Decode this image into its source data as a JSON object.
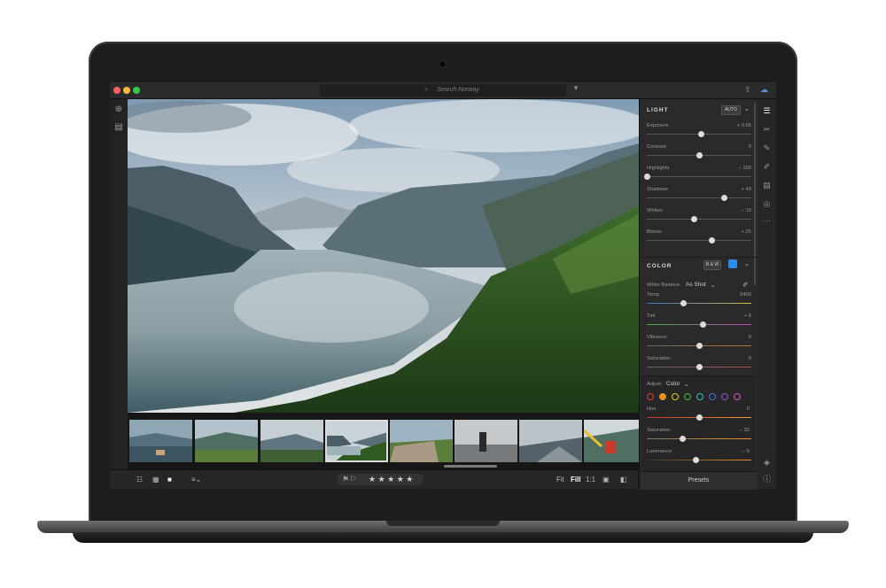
{
  "topbar": {
    "search_placeholder": "Search Norway",
    "icons": {
      "search": "search-icon",
      "filter": "filter-icon",
      "share": "share-icon",
      "cloud": "cloud-sync-icon"
    }
  },
  "leftbar": {
    "icons": [
      "add-icon",
      "library-icon"
    ]
  },
  "bottombar": {
    "fit": "Fit",
    "fill": "Fill",
    "one_to_one": "1:1",
    "stars": "★ ★ ★ ★ ★"
  },
  "panel": {
    "light": {
      "title": "LIGHT",
      "auto": "AUTO",
      "sliders": [
        {
          "label": "Exposure",
          "value": "+ 0.65",
          "level": 0.52
        },
        {
          "label": "Contrast",
          "value": "0",
          "level": 0.5
        },
        {
          "label": "Highlights",
          "value": "− 100",
          "level": 0.0
        },
        {
          "label": "Shadows",
          "value": "+ 49",
          "level": 0.74
        },
        {
          "label": "Whites",
          "value": "− 10",
          "level": 0.45
        },
        {
          "label": "Blacks",
          "value": "+ 25",
          "level": 0.62
        }
      ]
    },
    "color": {
      "title": "COLOR",
      "bw": "B & W",
      "white_balance_label": "White Balance",
      "white_balance_value": "As Shot",
      "sliders": [
        {
          "label": "Temp",
          "value": "5400",
          "level": 0.35
        },
        {
          "label": "Tint",
          "value": "+ 6",
          "level": 0.53
        },
        {
          "label": "Vibrance",
          "value": "0",
          "level": 0.5
        },
        {
          "label": "Saturation",
          "value": "0",
          "level": 0.5
        }
      ]
    },
    "adjust": {
      "label": "Adjust",
      "mode": "Color",
      "swatches": [
        "#e04040",
        "#e89020",
        "#e0d020",
        "#40c040",
        "#30c0c0",
        "#4070e0",
        "#9050e0",
        "#d050c0"
      ],
      "selected_swatch": 1,
      "sliders": [
        {
          "label": "Hue",
          "value": "0",
          "level": 0.5
        },
        {
          "label": "Saturation",
          "value": "− 32",
          "level": 0.34
        },
        {
          "label": "Luminance",
          "value": "− 5",
          "level": 0.47
        }
      ]
    },
    "presets": "Presets"
  },
  "toolstrip": {
    "icons": [
      "edit-sliders-icon",
      "crop-icon",
      "healing-brush-icon",
      "brush-icon",
      "linear-gradient-icon",
      "radial-gradient-icon",
      "more-icon",
      "tag-icon",
      "info-icon"
    ]
  },
  "colors": {
    "accent_blue": "#2d8ceb",
    "panel_bg": "#2a2a2a"
  }
}
